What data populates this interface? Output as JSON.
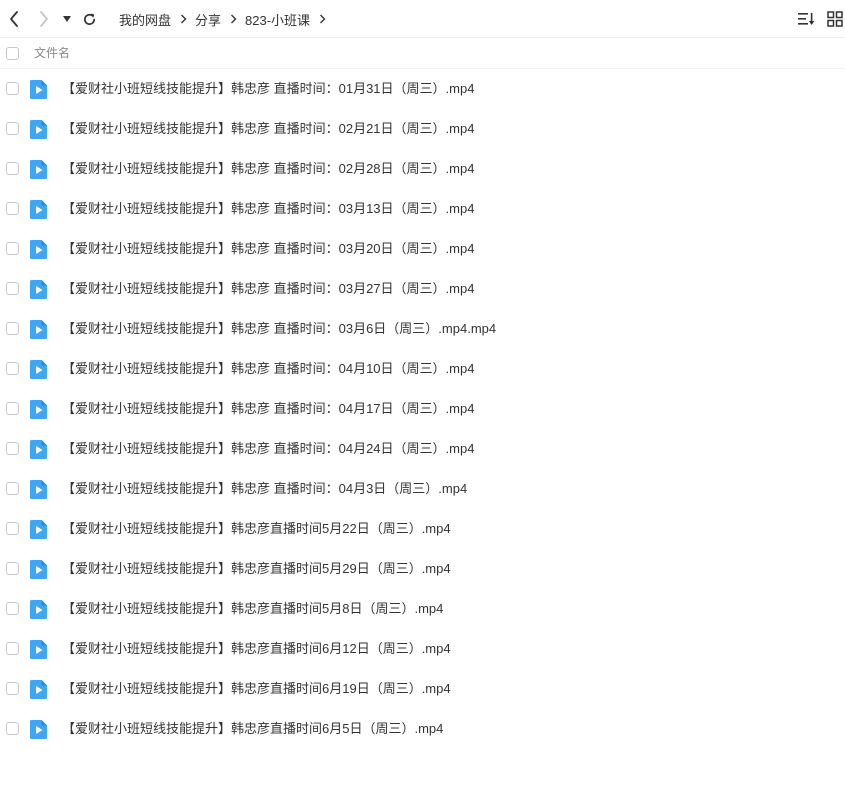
{
  "toolbar": {
    "breadcrumb": [
      "我的网盘",
      "分享",
      "823-小班课"
    ],
    "back_icon": "chevron-left-icon",
    "forward_icon": "chevron-right-icon",
    "history_icon": "caret-down-icon",
    "refresh_icon": "refresh-icon",
    "sort_icon": "sort-list-icon",
    "view_icon": "grid-view-icon"
  },
  "header": {
    "name_col": "文件名"
  },
  "colors": {
    "icon_blue": "#3da6f5",
    "icon_blue_dark": "#2b8be0",
    "disabled": "#c6c6c6"
  },
  "files": [
    "【爱财社小班短线技能提升】韩忠彦 直播时间：01月31日（周三）.mp4",
    "【爱财社小班短线技能提升】韩忠彦 直播时间：02月21日（周三）.mp4",
    "【爱财社小班短线技能提升】韩忠彦 直播时间：02月28日（周三）.mp4",
    "【爱财社小班短线技能提升】韩忠彦 直播时间：03月13日（周三）.mp4",
    "【爱财社小班短线技能提升】韩忠彦 直播时间：03月20日（周三）.mp4",
    "【爱财社小班短线技能提升】韩忠彦 直播时间：03月27日（周三）.mp4",
    "【爱财社小班短线技能提升】韩忠彦 直播时间：03月6日（周三）.mp4.mp4",
    "【爱财社小班短线技能提升】韩忠彦 直播时间：04月10日（周三）.mp4",
    "【爱财社小班短线技能提升】韩忠彦 直播时间：04月17日（周三）.mp4",
    "【爱财社小班短线技能提升】韩忠彦 直播时间：04月24日（周三）.mp4",
    "【爱财社小班短线技能提升】韩忠彦 直播时间：04月3日（周三）.mp4",
    "【爱财社小班短线技能提升】韩忠彦直播时间5月22日（周三）.mp4",
    "【爱财社小班短线技能提升】韩忠彦直播时间5月29日（周三）.mp4",
    "【爱财社小班短线技能提升】韩忠彦直播时间5月8日（周三）.mp4",
    "【爱财社小班短线技能提升】韩忠彦直播时间6月12日（周三）.mp4",
    "【爱财社小班短线技能提升】韩忠彦直播时间6月19日（周三）.mp4",
    "【爱财社小班短线技能提升】韩忠彦直播时间6月5日（周三）.mp4"
  ]
}
